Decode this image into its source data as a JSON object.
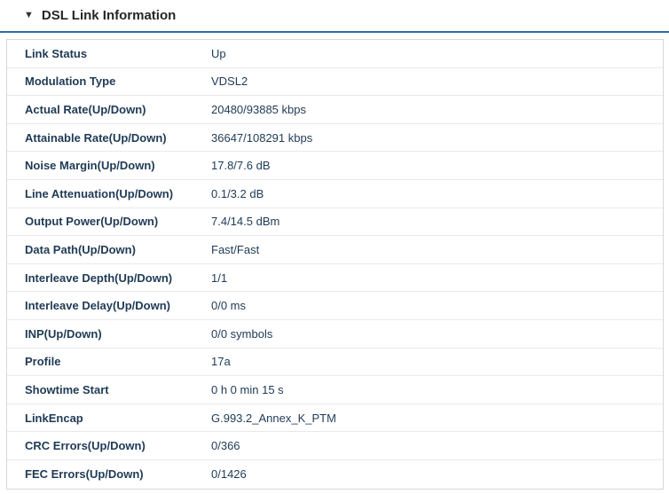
{
  "header": {
    "collapse_icon": "▼",
    "title": "DSL Link Information"
  },
  "colors": {
    "accent_line": "#2e6da4",
    "text": "#1f3a55",
    "row_divider": "#e9e9e9",
    "panel_border": "#d8d8d8"
  },
  "table": {
    "rows": [
      {
        "label": "Link Status",
        "value": "Up"
      },
      {
        "label": "Modulation Type",
        "value": "VDSL2"
      },
      {
        "label": "Actual Rate(Up/Down)",
        "value": "20480/93885 kbps"
      },
      {
        "label": "Attainable Rate(Up/Down)",
        "value": "36647/108291 kbps"
      },
      {
        "label": "Noise Margin(Up/Down)",
        "value": "17.8/7.6 dB"
      },
      {
        "label": "Line Attenuation(Up/Down)",
        "value": "0.1/3.2 dB"
      },
      {
        "label": "Output Power(Up/Down)",
        "value": "7.4/14.5 dBm"
      },
      {
        "label": "Data Path(Up/Down)",
        "value": "Fast/Fast"
      },
      {
        "label": "Interleave Depth(Up/Down)",
        "value": "1/1"
      },
      {
        "label": "Interleave Delay(Up/Down)",
        "value": "0/0 ms"
      },
      {
        "label": "INP(Up/Down)",
        "value": "0/0 symbols"
      },
      {
        "label": "Profile",
        "value": "17a"
      },
      {
        "label": "Showtime Start",
        "value": "0 h 0 min 15 s"
      },
      {
        "label": "LinkEncap",
        "value": "G.993.2_Annex_K_PTM"
      },
      {
        "label": "CRC Errors(Up/Down)",
        "value": "0/366"
      },
      {
        "label": "FEC Errors(Up/Down)",
        "value": "0/1426"
      }
    ]
  }
}
